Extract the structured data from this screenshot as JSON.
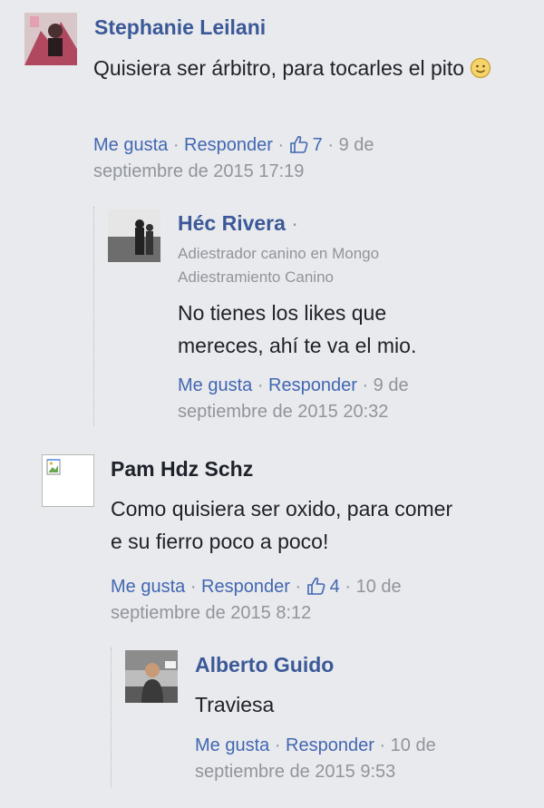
{
  "comments": [
    {
      "name": "Stephanie Leilani",
      "text": "Quisiera ser árbitro, para tocarles el pito",
      "emoji": "smiling-face-emoji",
      "like_label": "Me gusta",
      "reply_label": "Responder",
      "likes": "7",
      "date_line1": "9 de",
      "date_line2": "septiembre de 2015 17:19",
      "reply": {
        "name": "Héc Rivera",
        "byline1": "Adiestrador canino en Mongo",
        "byline2": "Adiestramiento Canino",
        "text_line1": "No tienes los likes que",
        "text_line2": "mereces, ahí te va el mio.",
        "like_label": "Me gusta",
        "reply_label": "Responder",
        "date_line1": "9 de",
        "date_line2": "septiembre de 2015 20:32"
      }
    },
    {
      "name": "Pam Hdz Schz",
      "text_line1": "Como quisiera ser oxido, para comer",
      "text_line2": "e su fierro poco a poco!",
      "like_label": "Me gusta",
      "reply_label": "Responder",
      "likes": "4",
      "date_line1": "10 de",
      "date_line2": "septiembre de 2015 8:12",
      "reply": {
        "name": "Alberto Guido",
        "text": "Traviesa",
        "like_label": "Me gusta",
        "reply_label": "Responder",
        "date_line1": "10 de",
        "date_line2": "septiembre de 2015 9:53"
      }
    }
  ],
  "colors": {
    "background": "#e9eaed",
    "link": "#4267b2",
    "name": "#3b5998",
    "meta": "#90949c"
  }
}
